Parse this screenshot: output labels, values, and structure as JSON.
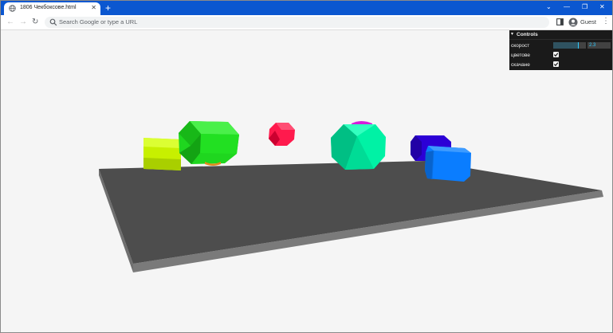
{
  "browser": {
    "tab": {
      "title": "1806 Чекбоксове.html",
      "close_glyph": "✕"
    },
    "new_tab_glyph": "+",
    "window_controls": {
      "chevron": "⌄",
      "minimize": "—",
      "restore": "❐",
      "close": "✕"
    },
    "nav": {
      "back": "←",
      "forward": "→",
      "reload": "↻"
    },
    "omnibox": {
      "placeholder": "Search Google or type a URL"
    },
    "profile": {
      "label": "Guest"
    },
    "menu_glyph": "⋮",
    "colors": {
      "tabbar": "#0b57d0",
      "toolbar": "#ffffff",
      "omnibox": "#f1f3f4"
    }
  },
  "controls": {
    "title": "Controls",
    "caret": "▾",
    "rows": [
      {
        "label": "скорост",
        "type": "slider",
        "value": "2.3",
        "fraction": 0.75
      },
      {
        "label": "цветове",
        "type": "checkbox",
        "checked": true,
        "mark": "✔"
      },
      {
        "label": "скачане",
        "type": "checkbox",
        "checked": true,
        "mark": "✔"
      }
    ]
  },
  "scene": {
    "background": "#f5f5f5",
    "ground_color": "#4d4d4d",
    "ground_edge_color": "#7a7a7a",
    "objects": [
      {
        "name": "yellow-green-cylinder",
        "color": "#c7f000"
      },
      {
        "name": "green-octagon",
        "color": "#1fd61f"
      },
      {
        "name": "red-octagon",
        "color": "#ff1a4d"
      },
      {
        "name": "magenta-cap",
        "color": "#d51ddb"
      },
      {
        "name": "teal-octagon",
        "color": "#00f2a5"
      },
      {
        "name": "purple-cylinder",
        "color": "#2c00d6"
      },
      {
        "name": "blue-cylinder",
        "color": "#0a7dff"
      }
    ]
  }
}
